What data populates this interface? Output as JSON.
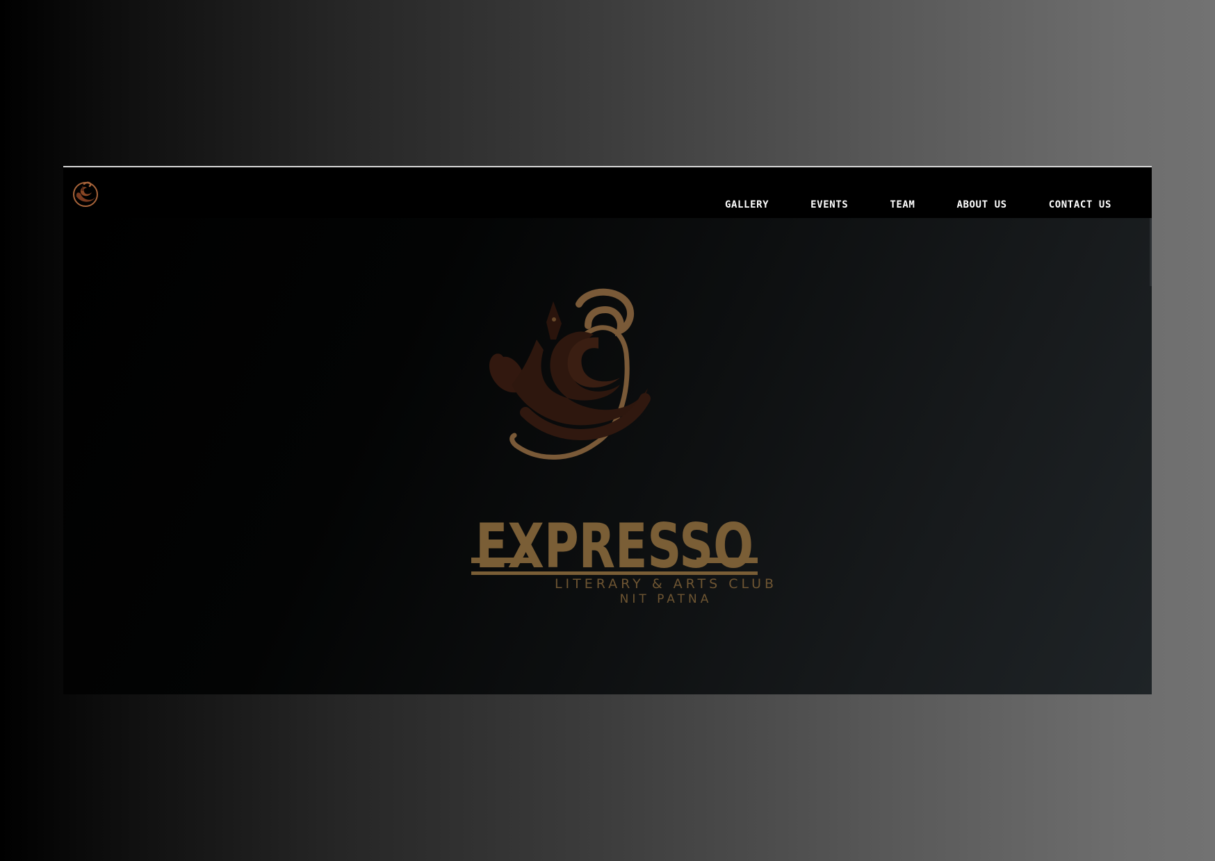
{
  "header": {
    "logo_icon": "expresso-logo-icon",
    "nav_items": [
      {
        "label": "GALLERY"
      },
      {
        "label": "EVENTS"
      },
      {
        "label": "TEAM"
      },
      {
        "label": "ABOUT US"
      },
      {
        "label": "CONTACT US"
      }
    ]
  },
  "hero": {
    "emblem_icon": "pen-brush-swirl-emblem",
    "wordmark": "EXPRESSO",
    "tagline": "LITERARY & ARTS CLUB",
    "subtagline": "NIT PATNA"
  },
  "colors": {
    "brand_gold": "#7a5e36",
    "brand_brown": "#301a12",
    "nav_text": "#ffffff",
    "navbar_bg": "#000000"
  }
}
